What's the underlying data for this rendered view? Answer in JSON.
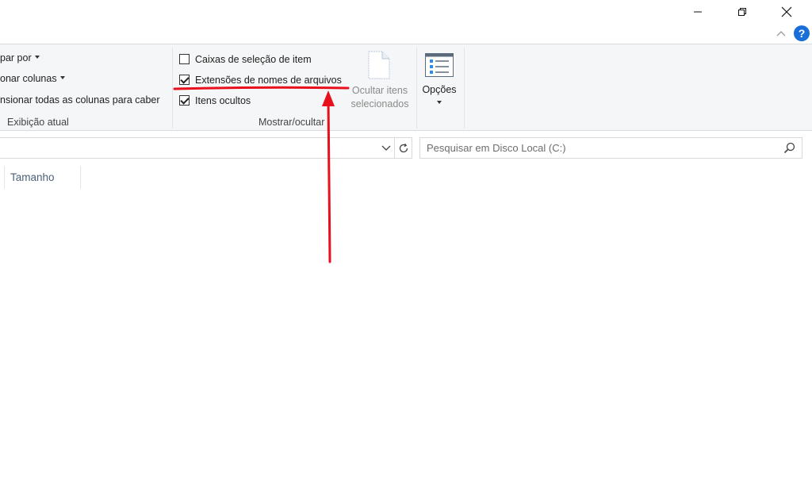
{
  "window_controls": {
    "minimize_icon": "minimize-icon",
    "maximize_icon": "restore-icon",
    "close_icon": "close-icon"
  },
  "ribbon_header": {
    "collapse_icon": "chevron-up-icon",
    "help_label": "?"
  },
  "ribbon": {
    "current_view": {
      "group_by": "par por",
      "add_columns": "onar colunas",
      "size_all_columns": "nsionar todas as colunas para caber",
      "group_label": "Exibição atual"
    },
    "show_hide": {
      "item_checkboxes": {
        "label": "Caixas de seleção de item",
        "checked": false
      },
      "file_name_extensions": {
        "label": "Extensões de nomes de arquivos",
        "checked": true
      },
      "hidden_items": {
        "label": "Itens ocultos",
        "checked": true
      },
      "hide_selected_items": "Ocultar itens selecionados",
      "group_label": "Mostrar/ocultar"
    },
    "options": {
      "label": "Opções"
    }
  },
  "search": {
    "placeholder": "Pesquisar em Disco Local (C:)"
  },
  "columns": {
    "size_header": "Tamanho"
  },
  "colors": {
    "annotation_red": "#e8101c",
    "help_blue": "#1a6ed8",
    "column_header_text": "#4c607a"
  }
}
